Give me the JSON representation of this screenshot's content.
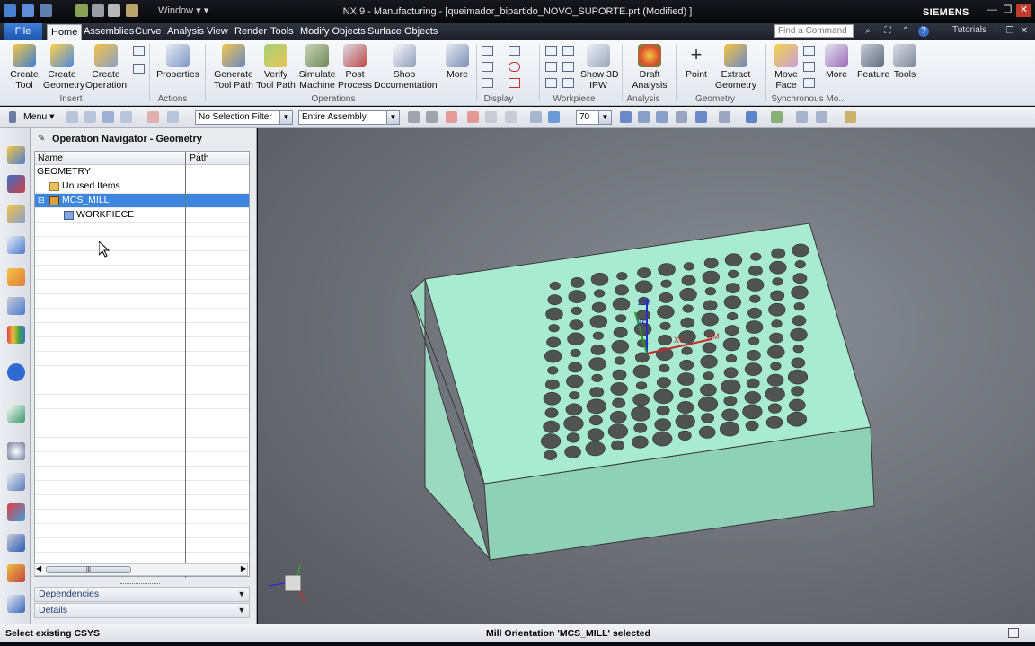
{
  "titlebar": {
    "title": "NX 9 - Manufacturing - [queimador_bipartido_NOVO_SUPORTE.prt (Modified) ]",
    "brand": "SIEMENS",
    "window_menu": "Window"
  },
  "tabs": [
    "File",
    "Home",
    "Assemblies",
    "Curve",
    "Analysis",
    "View",
    "Render",
    "Tools",
    "Modify Objects",
    "Surface Objects"
  ],
  "find_command": "Find a Command",
  "tutorials": "Tutorials",
  "ribbon": {
    "create_tool": "Create\nTool",
    "create_geometry": "Create\nGeometry",
    "create_operation": "Create\nOperation",
    "properties": "Properties",
    "generate_tool_path": "Generate\nTool Path",
    "verify_tool_path": "Verify\nTool Path",
    "simulate_machine": "Simulate\nMachine",
    "post_process": "Post\nProcess",
    "shop_documentation": "Shop\nDocumentation",
    "more1": "More",
    "show_3d_ipw": "Show 3D\nIPW",
    "draft_analysis": "Draft\nAnalysis",
    "point": "Point",
    "extract_geometry": "Extract\nGeometry",
    "move_face": "Move\nFace",
    "more2": "More",
    "feature": "Feature",
    "tools": "Tools",
    "groups": {
      "insert": "Insert",
      "actions": "Actions",
      "operations": "Operations",
      "display": "Display",
      "workpiece": "Workpiece",
      "analysis": "Analysis",
      "geometry": "Geometry",
      "sync": "Synchronous Mo..."
    }
  },
  "selection_bar": {
    "menu": "Menu",
    "filter": "No Selection Filter",
    "scope": "Entire Assembly",
    "zoom": "70"
  },
  "navigator": {
    "title": "Operation Navigator - Geometry",
    "col_name": "Name",
    "col_path": "Path",
    "rows": [
      "GEOMETRY",
      "Unused Items",
      "MCS_MILL",
      "WORKPIECE"
    ],
    "dependencies": "Dependencies",
    "details": "Details"
  },
  "viewport": {
    "labels": {
      "zm": "ZM",
      "zc": "ZC",
      "xc": "XC",
      "xm": "XM"
    }
  },
  "status": {
    "left": "Select existing CSYS",
    "center": "Mill Orientation 'MCS_MILL' selected"
  },
  "colors": {
    "part_top": "#a8ebd1",
    "part_side": "#8fd1b6",
    "hole": "#4f5453",
    "selected": "#3d86df",
    "file_tab": "#2a68c4"
  }
}
